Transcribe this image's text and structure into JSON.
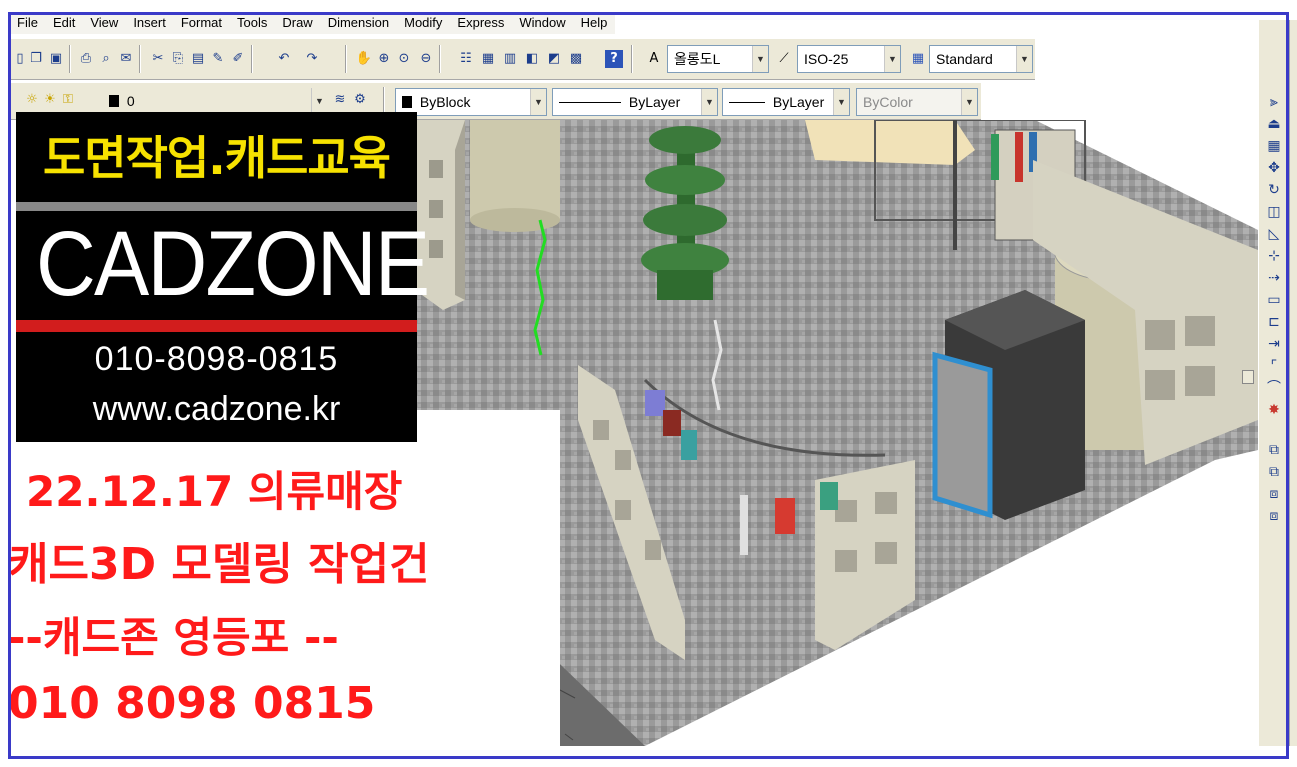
{
  "menubar": {
    "items": [
      "File",
      "Edit",
      "View",
      "Insert",
      "Format",
      "Tools",
      "Draw",
      "Dimension",
      "Modify",
      "Express",
      "Window",
      "Help"
    ]
  },
  "toolbar": {
    "text_style": "올롱도L",
    "dim_style": "ISO-25",
    "table_style": "Standard",
    "layer": "0",
    "color": "ByBlock",
    "linetype": "ByLayer",
    "lineweight": "ByLayer",
    "plot_style": "ByColor",
    "icons": [
      "new-icon",
      "open-icon",
      "save-icon",
      "plot-icon",
      "preview-icon",
      "publish-icon",
      "cut-icon",
      "copy-icon",
      "paste-icon",
      "match-properties-icon",
      "block-editor-icon",
      "undo-icon",
      "redo-icon",
      "pan-icon",
      "zoom-realtime-icon",
      "zoom-window-icon",
      "zoom-previous-icon",
      "properties-icon",
      "design-center-icon",
      "tool-palettes-icon",
      "sheet-set-icon",
      "markup-icon",
      "calculator-icon",
      "help-icon"
    ]
  },
  "logo": {
    "top_text": "도면작업.캐드교육",
    "brand": "CADZONE",
    "phone": "010-8098-0815",
    "url": "www.cadzone.kr"
  },
  "notice": {
    "line1": "22.12.17 의류매장",
    "line2": "캐드3D 모델링 작업건",
    "line3": "--캐드존 영등포 --",
    "line4": "010 8098 0815"
  },
  "colors": {
    "frame": "#3a3ac8",
    "toolbar_bg": "#ece9d8",
    "notice_text": "#ff1a1a",
    "logo_yellow": "#f7e200",
    "logo_red": "#d21d1d",
    "floor": "#9c9c9c",
    "wall": "#d6d3c2",
    "column": "#cdc9ad",
    "tree": "#3b7a3b"
  }
}
